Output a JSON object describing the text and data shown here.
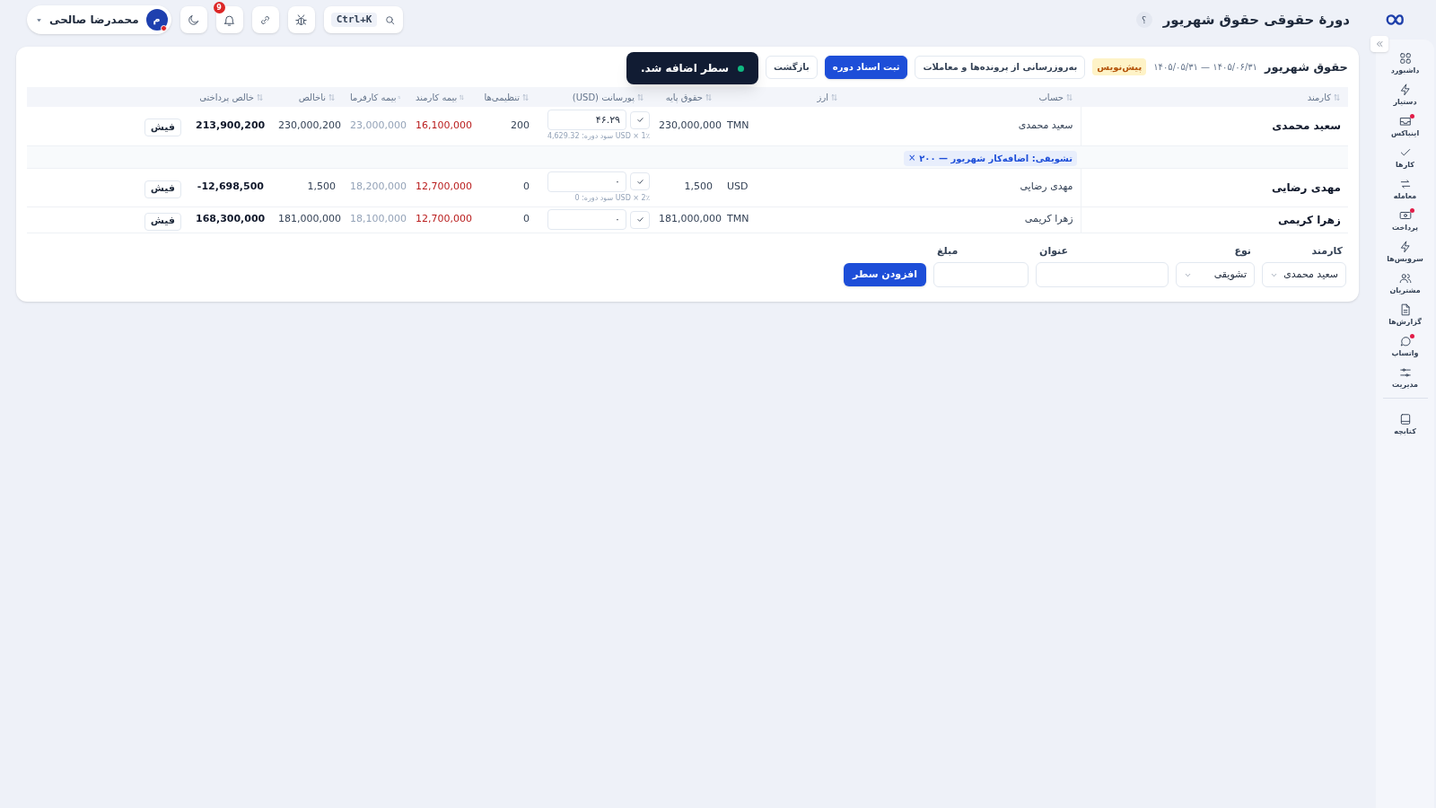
{
  "topbar": {
    "title": "دورهٔ حقوقی حقوق شهریور",
    "help": "؟",
    "search_shortcut": "Ctrl+K",
    "notifications": "9",
    "user": {
      "name": "محمدرضا صالحی",
      "initial": "م",
      "alert": true
    }
  },
  "sidebar": {
    "items": [
      {
        "label": "داشبورد",
        "dot": false
      },
      {
        "label": "دستیار",
        "dot": false
      },
      {
        "label": "اینباکس",
        "dot": true
      },
      {
        "label": "کارها",
        "dot": false
      },
      {
        "label": "معامله",
        "dot": false
      },
      {
        "label": "پرداخت",
        "dot": true
      },
      {
        "label": "سرویس‌ها",
        "dot": false
      },
      {
        "label": "مشتریان",
        "dot": false
      },
      {
        "label": "گزارش‌ها",
        "dot": false
      },
      {
        "label": "واتساپ",
        "dot": true
      },
      {
        "label": "مدیریت",
        "dot": false
      },
      {
        "label": "کتابچه",
        "dot": false
      }
    ]
  },
  "page": {
    "title": "حقوق شهریور",
    "period": "۱۴۰۵/۰۶/۳۱ — ۱۴۰۵/۰۵/۳۱",
    "status": "پیش‌نویس",
    "actions": [
      {
        "label": "به‌روزرسانی از پرونده‌ها و معاملات",
        "kind": "secondary"
      },
      {
        "label": "ثبت اسناد دوره",
        "kind": "primary"
      },
      {
        "label": "بازگشت",
        "kind": "secondary"
      }
    ]
  },
  "toast": {
    "message": "سطر اضافه شد."
  },
  "table": {
    "columns": [
      "کارمند",
      "حساب",
      "ارز",
      "حقوق پایه",
      "پورسانت (USD)",
      "تنظیمی‌ها",
      "بیمه کارمند",
      "بیمه کارفرما",
      "ناخالص",
      "خالص پرداختی"
    ],
    "rows": [
      {
        "kind": "employee",
        "employee": "سعید محمدی",
        "account": "سعید محمدی",
        "currency": "TMN",
        "base_salary": "230,000,000",
        "commission": "۴۶.۲۹",
        "commission_note": "1٪ × USD سود دوره: 4,629.32",
        "adjustments": "200",
        "employee_insurance": "16,100,000",
        "employer_insurance": "23,000,000",
        "gross": "230,000,200",
        "net": "213,900,200",
        "slip": "فیش"
      },
      {
        "kind": "adjustment",
        "label": "تشویقی: اضافه‌کار شهریور — ۲۰۰",
        "remove": "×"
      },
      {
        "kind": "employee",
        "employee": "مهدی رضایی",
        "account": "مهدی رضایی",
        "currency": "USD",
        "base_salary": "1,500",
        "commission": "۰",
        "commission_note": "2٪ × USD سود دوره: 0",
        "adjustments": "0",
        "employee_insurance": "12,700,000",
        "employer_insurance": "18,200,000",
        "gross": "1,500",
        "net": "-12,698,500",
        "slip": "فیش"
      },
      {
        "kind": "employee",
        "employee": "زهرا کریمی",
        "account": "زهرا کریمی",
        "currency": "TMN",
        "base_salary": "181,000,000",
        "commission": "۰",
        "adjustments": "0",
        "employee_insurance": "12,700,000",
        "employer_insurance": "18,100,000",
        "gross": "181,000,000",
        "net": "168,300,000",
        "slip": "فیش"
      }
    ]
  },
  "form": {
    "fields": [
      {
        "label": "کارمند",
        "kind": "select",
        "value": "سعید محمدی"
      },
      {
        "label": "نوع",
        "kind": "select",
        "value": "تشویقی"
      },
      {
        "label": "عنوان",
        "kind": "text"
      },
      {
        "label": "مبلغ",
        "kind": "text"
      }
    ],
    "submit": "افزودن سطر"
  }
}
